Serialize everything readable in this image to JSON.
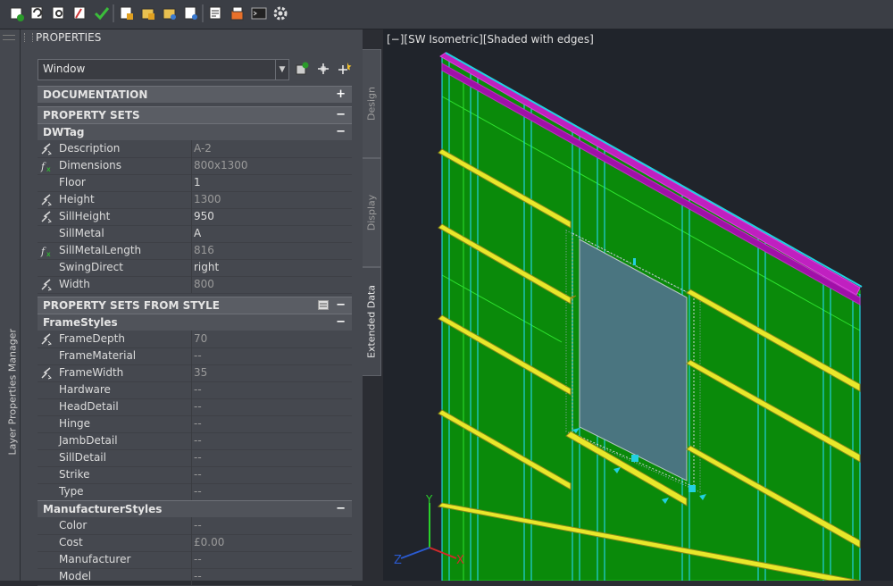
{
  "toolbar": {
    "buttons": [
      "new-icon",
      "refresh-icon",
      "zoom-icon",
      "style-icon",
      "check-icon",
      "edit-icon",
      "folder-edit-icon",
      "folder-settings-icon",
      "sheet-settings-icon",
      "properties-icon",
      "layer-icon",
      "terminal-icon",
      "gear-icon"
    ]
  },
  "side_strip": {
    "label": "Layer Properties Manager"
  },
  "palette": {
    "title": "PROPERTIES",
    "selector": {
      "value": "Window"
    },
    "tabs": [
      "Design",
      "Display",
      "Extended Data"
    ],
    "sections": {
      "documentation": {
        "title": "DOCUMENTATION",
        "toggle": "+"
      },
      "property_sets": {
        "title": "PROPERTY SETS",
        "toggle": "−"
      },
      "dwtag": {
        "title": "DWTag",
        "toggle": "−"
      },
      "property_sets_from_style": {
        "title": "PROPERTY SETS FROM STYLE",
        "toggle": "−"
      },
      "frame_styles": {
        "title": "FrameStyles",
        "toggle": "−"
      },
      "manufacturer_styles": {
        "title": "ManufacturerStyles",
        "toggle": "−"
      }
    },
    "dwtag_rows": [
      {
        "label": "Description",
        "value": "A-2",
        "icon": "lightning-icon",
        "dim": true
      },
      {
        "label": "Dimensions",
        "value": "800x1300",
        "icon": "formula-icon",
        "dim": true
      },
      {
        "label": "Floor",
        "value": "1",
        "icon": "",
        "dim": false
      },
      {
        "label": "Height",
        "value": "1300",
        "icon": "lightning-icon",
        "dim": true
      },
      {
        "label": "SillHeight",
        "value": "950",
        "icon": "lightning-icon",
        "dim": false
      },
      {
        "label": "SillMetal",
        "value": "A",
        "icon": "",
        "dim": false
      },
      {
        "label": "SillMetalLength",
        "value": "816",
        "icon": "formula-icon",
        "dim": true
      },
      {
        "label": "SwingDirect",
        "value": "right",
        "icon": "",
        "dim": false
      },
      {
        "label": "Width",
        "value": "800",
        "icon": "lightning-icon",
        "dim": true
      }
    ],
    "frame_rows": [
      {
        "label": "FrameDepth",
        "value": "70",
        "icon": "lightning-icon",
        "dim": true
      },
      {
        "label": "FrameMaterial",
        "value": "--",
        "icon": "",
        "dim": true
      },
      {
        "label": "FrameWidth",
        "value": "35",
        "icon": "lightning-icon",
        "dim": true
      },
      {
        "label": "Hardware",
        "value": "--",
        "icon": "",
        "dim": true
      },
      {
        "label": "HeadDetail",
        "value": "--",
        "icon": "",
        "dim": true
      },
      {
        "label": "Hinge",
        "value": "--",
        "icon": "",
        "dim": true
      },
      {
        "label": "JambDetail",
        "value": "--",
        "icon": "",
        "dim": true
      },
      {
        "label": "SillDetail",
        "value": "--",
        "icon": "",
        "dim": true
      },
      {
        "label": "Strike",
        "value": "--",
        "icon": "",
        "dim": true
      },
      {
        "label": "Type",
        "value": "--",
        "icon": "",
        "dim": true
      }
    ],
    "manufacturer_rows": [
      {
        "label": "Color",
        "value": "--",
        "icon": "",
        "dim": true
      },
      {
        "label": "Cost",
        "value": "£0.00",
        "icon": "",
        "dim": true
      },
      {
        "label": "Manufacturer",
        "value": "--",
        "icon": "",
        "dim": true
      },
      {
        "label": "Model",
        "value": "--",
        "icon": "",
        "dim": true
      }
    ]
  },
  "viewport": {
    "label": "[−][SW Isometric][Shaded with edges]",
    "axis_labels": {
      "x": "X",
      "y": "Y",
      "z": "Z"
    },
    "colors": {
      "wall": "#0a8a0a",
      "rail": "#e8e82a",
      "stud": "#22d0e0",
      "top_plate": "#c020c0",
      "glass": "#4a7580",
      "background": "#20242b"
    }
  }
}
